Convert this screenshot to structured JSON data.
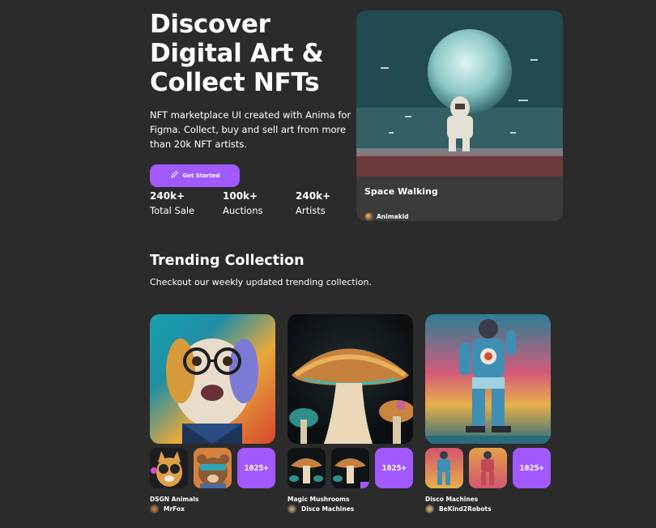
{
  "hero": {
    "title": "Discover Digital Art & Collect NFTs",
    "subtitle": "NFT marketplace UI created with Anima for Figma. Collect, buy and sell art from more than 20k NFT artists.",
    "cta_label": "Get Started",
    "stats": [
      {
        "value": "240k+",
        "label": "Total Sale"
      },
      {
        "value": "100k+",
        "label": "Auctions"
      },
      {
        "value": "240k+",
        "label": "Artists"
      }
    ]
  },
  "featured": {
    "title": "Space Walking",
    "artist": "Animakid"
  },
  "trending": {
    "title": "Trending Collection",
    "subtitle": "Checkout our weekly updated trending collection.",
    "collections": [
      {
        "name": "DSGN Animals",
        "artist": "MrFox",
        "count": "1025+"
      },
      {
        "name": "Magic Mushrooms",
        "artist": "Disco Machines",
        "count": "1025+"
      },
      {
        "name": "Disco Machines",
        "artist": "BeKind2Robots",
        "count": "1025+"
      }
    ]
  },
  "colors": {
    "background": "#2b2b2b",
    "card": "#3b3b3b",
    "accent": "#a259ff"
  },
  "icons": [
    "rocket-icon"
  ]
}
